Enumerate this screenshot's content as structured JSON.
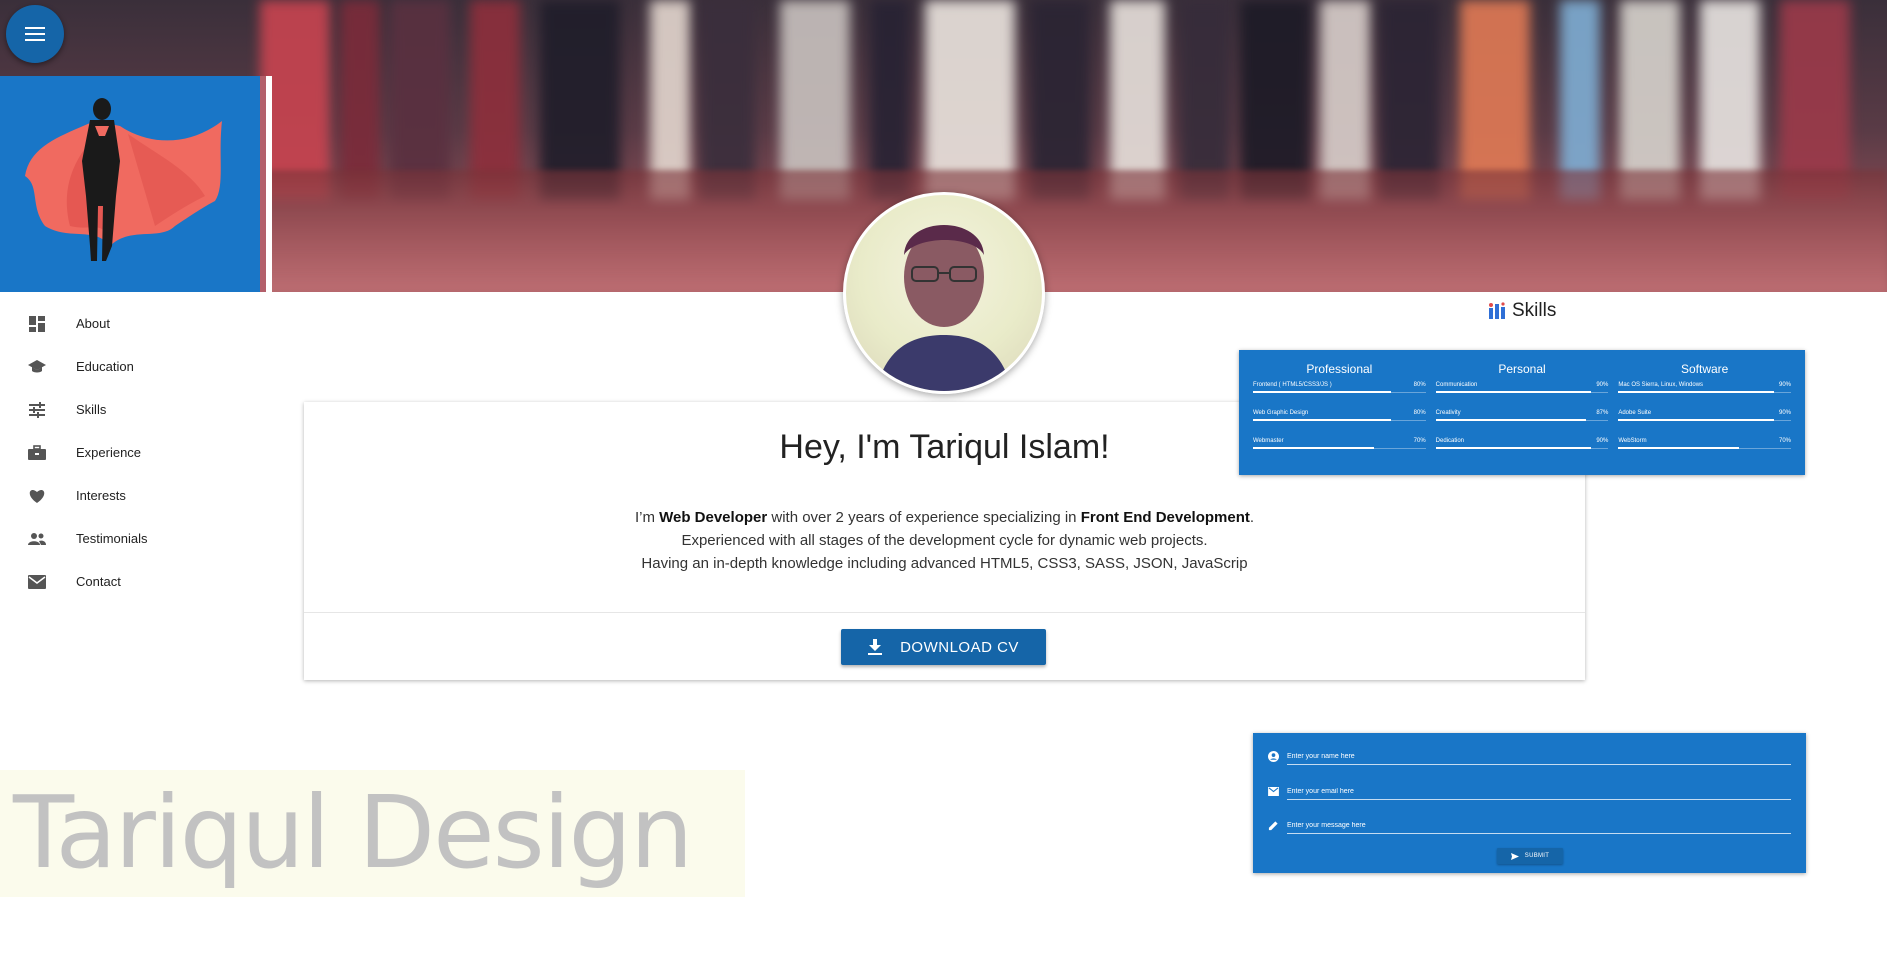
{
  "header": {
    "menu_icon": "menu-icon"
  },
  "sidebar": {
    "items": [
      {
        "label": "About",
        "icon": "dashboard-icon"
      },
      {
        "label": "Education",
        "icon": "graduation-cap-icon"
      },
      {
        "label": "Skills",
        "icon": "tune-sliders-icon"
      },
      {
        "label": "Experience",
        "icon": "briefcase-icon"
      },
      {
        "label": "Interests",
        "icon": "heart-icon"
      },
      {
        "label": "Testimonials",
        "icon": "people-icon"
      },
      {
        "label": "Contact",
        "icon": "mail-icon"
      }
    ]
  },
  "intro": {
    "title": "Hey, I'm Tariqul Islam!",
    "line1_prefix": "I’m ",
    "line1_role": "Web Developer",
    "line1_mid": " with over 2 years of experience specializing in ",
    "line1_spec": "Front End Development",
    "line1_suffix": ".",
    "line2": "Experienced with all stages of the development cycle for dynamic web projects.",
    "line3": "Having an in-depth knowledge including advanced HTML5, CSS3, SASS, JSON, JavaScrip",
    "download_label": "DOWNLOAD CV"
  },
  "skills": {
    "heading": "Skills",
    "columns": [
      {
        "title": "Professional",
        "items": [
          {
            "name": "Frontend ( HTML5/CSS3/JS )",
            "percent": "80%",
            "value": 0.8
          },
          {
            "name": "Web Graphic Design",
            "percent": "80%",
            "value": 0.8
          },
          {
            "name": "Webmaster",
            "percent": "70%",
            "value": 0.7
          }
        ]
      },
      {
        "title": "Personal",
        "items": [
          {
            "name": "Communication",
            "percent": "90%",
            "value": 0.9
          },
          {
            "name": "Creativity",
            "percent": "87%",
            "value": 0.87
          },
          {
            "name": "Dedication",
            "percent": "90%",
            "value": 0.9
          }
        ]
      },
      {
        "title": "Software",
        "items": [
          {
            "name": "Mac OS Sierra, Linux, Windows",
            "percent": "90%",
            "value": 0.9
          },
          {
            "name": "Adobe Suite",
            "percent": "90%",
            "value": 0.9
          },
          {
            "name": "WebStorm",
            "percent": "70%",
            "value": 0.7
          }
        ]
      }
    ]
  },
  "contact": {
    "name_placeholder": "Enter your name here",
    "email_placeholder": "Enter your email here",
    "message_placeholder": "Enter your message here",
    "submit_label": "SUBMIT"
  },
  "brand": {
    "text": "Tariqul Design"
  },
  "colors": {
    "primary": "#1976c7",
    "primary_dark": "#1565a8",
    "banner_accent": "#b35f6a"
  }
}
